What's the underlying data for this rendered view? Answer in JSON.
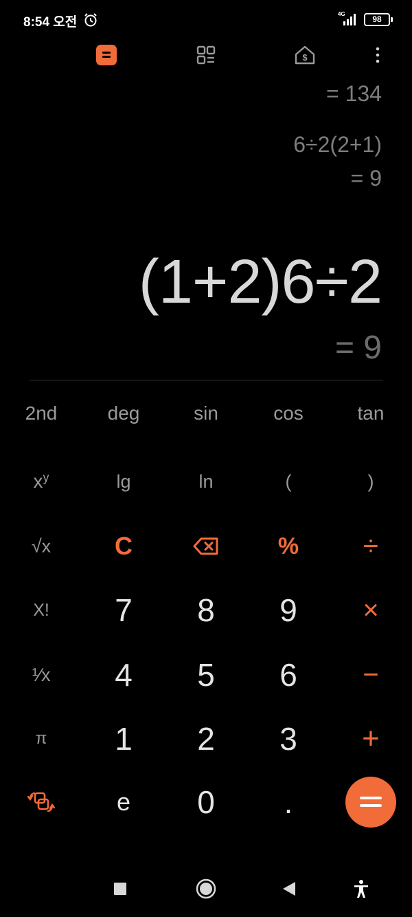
{
  "status_bar": {
    "time": "8:54 오전",
    "network": "4G",
    "battery": "98"
  },
  "history": [
    {
      "result": "= 134"
    },
    {
      "expression": "6÷2(2+1)",
      "result": "= 9"
    }
  ],
  "display": {
    "expression": "(1+2)6÷2",
    "result": "= 9"
  },
  "keys": {
    "row1": [
      "2nd",
      "deg",
      "sin",
      "cos",
      "tan"
    ],
    "row2": {
      "power": "x",
      "power_sup": "y",
      "lg": "lg",
      "ln": "ln",
      "open_paren": "(",
      "close_paren": ")"
    },
    "row3": {
      "sqrt": "√x",
      "clear": "C",
      "percent": "%",
      "divide": "÷"
    },
    "row4": {
      "factorial": "X!",
      "n7": "7",
      "n8": "8",
      "n9": "9",
      "multiply": "×"
    },
    "row5": {
      "reciprocal": "¹⁄x",
      "n4": "4",
      "n5": "5",
      "n6": "6",
      "minus": "−"
    },
    "row6": {
      "pi": "π",
      "n1": "1",
      "n2": "2",
      "n3": "3",
      "plus": "+"
    },
    "row7": {
      "e": "e",
      "n0": "0",
      "dot": "."
    }
  },
  "colors": {
    "accent": "#f26c3a",
    "background": "#000000"
  }
}
